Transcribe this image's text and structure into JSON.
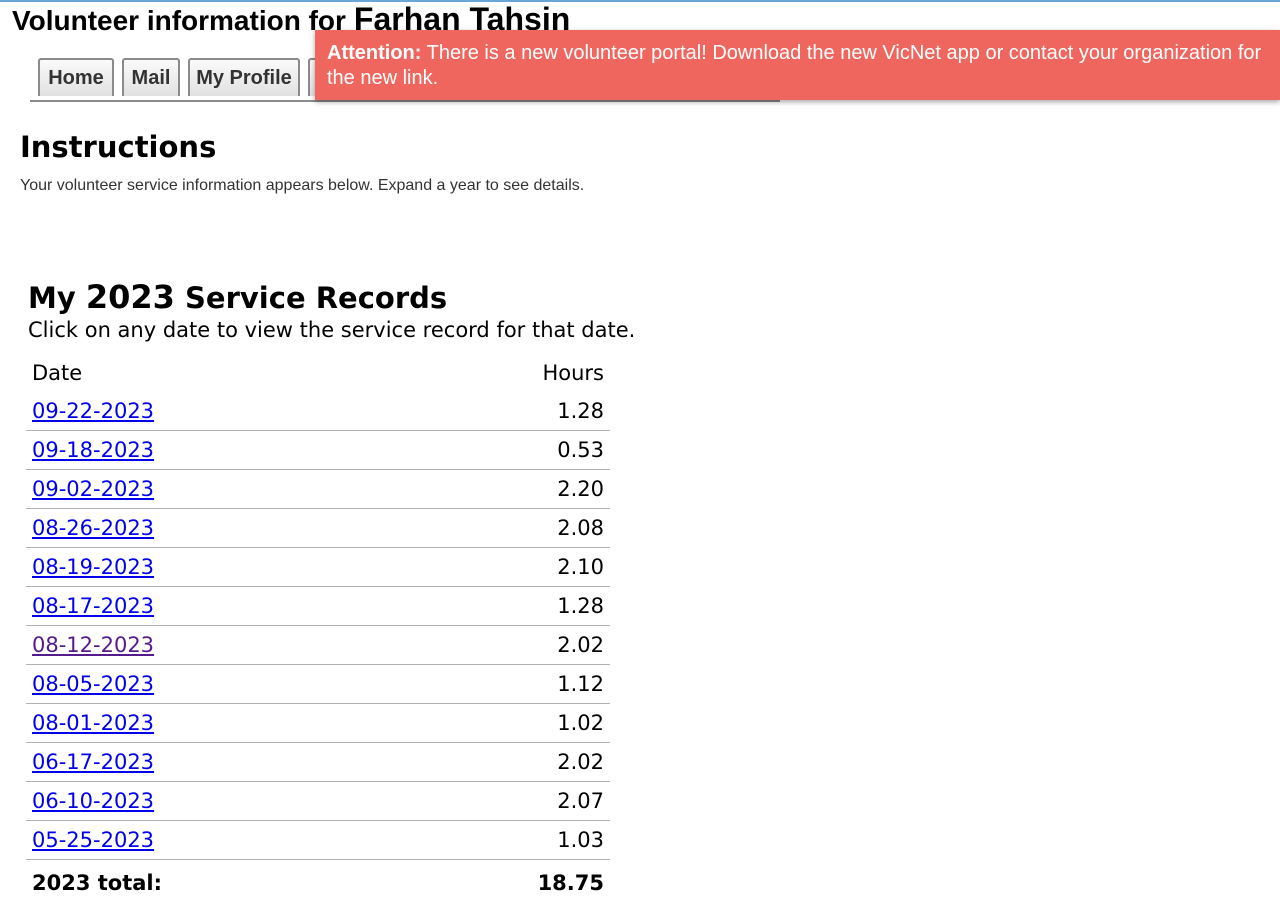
{
  "header": {
    "title_prefix": "Volunteer information for",
    "volunteer_name": "Farhan Tahsin"
  },
  "tabs": [
    {
      "label": "Home"
    },
    {
      "label": "Mail"
    },
    {
      "label": "My Profile"
    }
  ],
  "alert": {
    "label": "Attention:",
    "message": "There is a new volunteer portal! Download the new VicNet app or contact your organization for the new link.",
    "background": "#ef665e"
  },
  "instructions": {
    "heading": "Instructions",
    "text": "Your volunteer service information appears below. Expand a year to see details."
  },
  "records": {
    "heading_prefix": "My",
    "year": "2023",
    "heading_suffix": "Service Records",
    "subtitle": "Click on any date to view the service record for that date.",
    "columns": {
      "date": "Date",
      "hours": "Hours"
    },
    "rows": [
      {
        "date": "09-22-2023",
        "hours": "1.28"
      },
      {
        "date": "09-18-2023",
        "hours": "0.53"
      },
      {
        "date": "09-02-2023",
        "hours": "2.20"
      },
      {
        "date": "08-26-2023",
        "hours": "2.08"
      },
      {
        "date": "08-19-2023",
        "hours": "2.10"
      },
      {
        "date": "08-17-2023",
        "hours": "1.28"
      },
      {
        "date": "08-12-2023",
        "hours": "2.02"
      },
      {
        "date": "08-05-2023",
        "hours": "1.12"
      },
      {
        "date": "08-01-2023",
        "hours": "1.02"
      },
      {
        "date": "06-17-2023",
        "hours": "2.02"
      },
      {
        "date": "06-10-2023",
        "hours": "2.07"
      },
      {
        "date": "05-25-2023",
        "hours": "1.03"
      }
    ],
    "total_label": "2023 total:",
    "total_value": "18.75",
    "link_color": "#0000ee",
    "visited_link_color": "#551a8b"
  }
}
